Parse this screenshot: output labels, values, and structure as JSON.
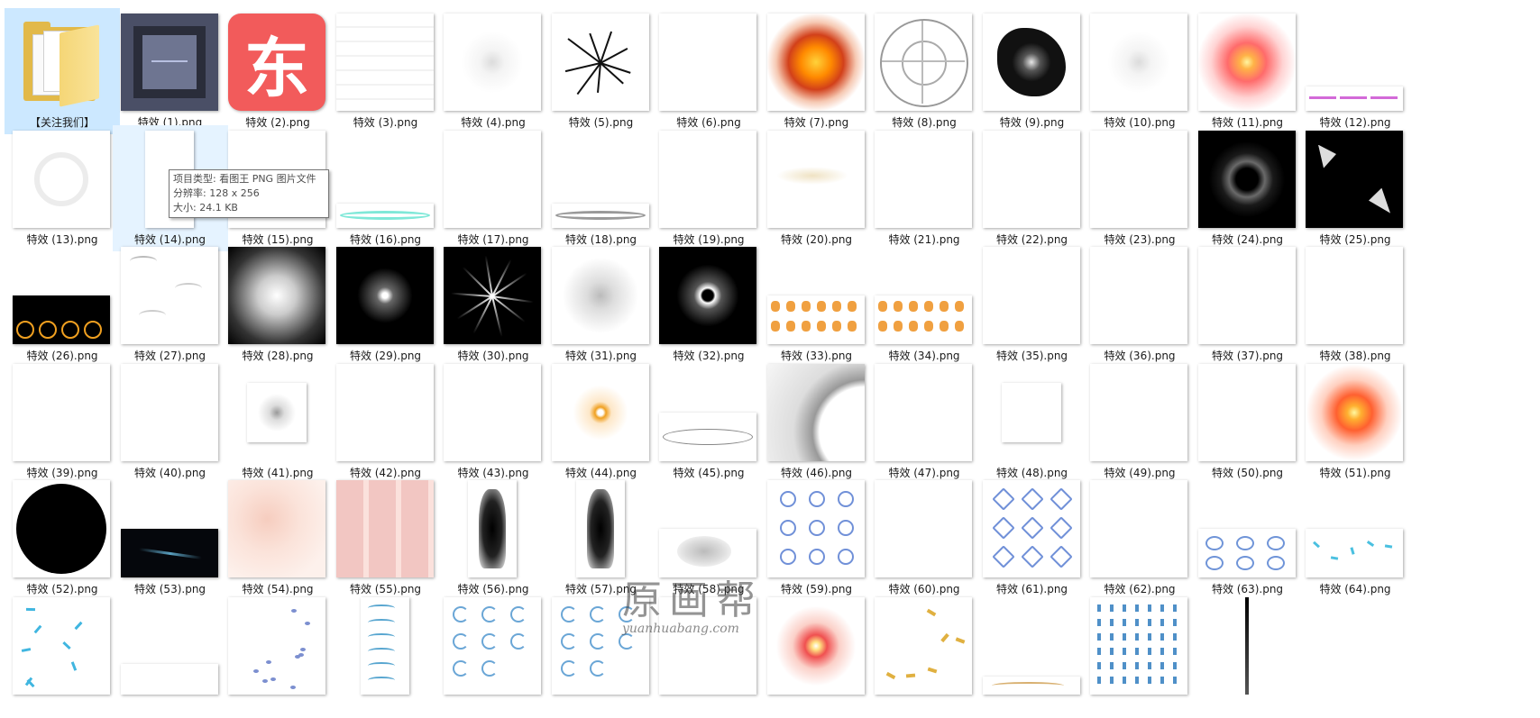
{
  "folder": {
    "label": "【关注我们】"
  },
  "dong_glyph": "东",
  "tooltip": {
    "type_line": "项目类型: 看图王 PNG 图片文件",
    "resolution_line": "分辨率: 128 x 256",
    "size_line": "大小: 24.1 KB"
  },
  "watermark": {
    "main": "原画帮",
    "url": "yuanhuabang.com"
  },
  "files": [
    {
      "label": "特效 (1).png",
      "thumb": "dark-frame"
    },
    {
      "label": "特效 (2).png",
      "thumb": "red-logo"
    },
    {
      "label": "特效 (3).png",
      "thumb": "faint-strokes"
    },
    {
      "label": "特效 (4).png",
      "thumb": "faint-burst"
    },
    {
      "label": "特效 (5).png",
      "thumb": "black-crack"
    },
    {
      "label": "特效 (6).png",
      "thumb": "blank"
    },
    {
      "label": "特效 (7).png",
      "thumb": "fire-crack"
    },
    {
      "label": "特效 (8).png",
      "thumb": "magic-circle"
    },
    {
      "label": "特效 (9).png",
      "thumb": "black-splash"
    },
    {
      "label": "特效 (10).png",
      "thumb": "faint-burst"
    },
    {
      "label": "特效 (11).png",
      "thumb": "red-flare"
    },
    {
      "label": "特效 (12).png",
      "thumb": "pink-lines"
    },
    {
      "label": "特效 (13).png",
      "thumb": "faint-ring"
    },
    {
      "label": "特效 (14).png",
      "thumb": "blank-tall"
    },
    {
      "label": "特效 (15).png",
      "thumb": "blank"
    },
    {
      "label": "特效 (16).png",
      "thumb": "cyan-ring"
    },
    {
      "label": "特效 (17).png",
      "thumb": "blank"
    },
    {
      "label": "特效 (18).png",
      "thumb": "grey-ring"
    },
    {
      "label": "特效 (19).png",
      "thumb": "blank"
    },
    {
      "label": "特效 (20).png",
      "thumb": "beige-smear"
    },
    {
      "label": "特效 (21).png",
      "thumb": "blank"
    },
    {
      "label": "特效 (22).png",
      "thumb": "blank"
    },
    {
      "label": "特效 (23).png",
      "thumb": "blank"
    },
    {
      "label": "特效 (24).png",
      "thumb": "black-ring"
    },
    {
      "label": "特效 (25).png",
      "thumb": "black-shards"
    },
    {
      "label": "特效 (26).png",
      "thumb": "fire-rings"
    },
    {
      "label": "特效 (27).png",
      "thumb": "grey-wisps"
    },
    {
      "label": "特效 (28).png",
      "thumb": "white-glow-dark"
    },
    {
      "label": "特效 (29).png",
      "thumb": "white-star-dark"
    },
    {
      "label": "特效 (30).png",
      "thumb": "rays-dark"
    },
    {
      "label": "特效 (31).png",
      "thumb": "grey-star"
    },
    {
      "label": "特效 (32).png",
      "thumb": "dark-hole"
    },
    {
      "label": "特效 (33).png",
      "thumb": "orange-frames"
    },
    {
      "label": "特效 (34).png",
      "thumb": "orange-frames"
    },
    {
      "label": "特效 (35).png",
      "thumb": "blank"
    },
    {
      "label": "特效 (36).png",
      "thumb": "blank"
    },
    {
      "label": "特效 (37).png",
      "thumb": "blank"
    },
    {
      "label": "特效 (38).png",
      "thumb": "blank"
    },
    {
      "label": "特效 (39).png",
      "thumb": "blank"
    },
    {
      "label": "特效 (40).png",
      "thumb": "blank"
    },
    {
      "label": "特效 (41).png",
      "thumb": "grey-dot-small"
    },
    {
      "label": "特效 (42).png",
      "thumb": "blank"
    },
    {
      "label": "特效 (43).png",
      "thumb": "blank"
    },
    {
      "label": "特效 (44).png",
      "thumb": "orange-dot"
    },
    {
      "label": "特效 (45).png",
      "thumb": "lens-line"
    },
    {
      "label": "特效 (46).png",
      "thumb": "grey-arc"
    },
    {
      "label": "特效 (47).png",
      "thumb": "blank"
    },
    {
      "label": "特效 (48).png",
      "thumb": "blank-small"
    },
    {
      "label": "特效 (49).png",
      "thumb": "blank"
    },
    {
      "label": "特效 (50).png",
      "thumb": "blank"
    },
    {
      "label": "特效 (51).png",
      "thumb": "orange-sun"
    },
    {
      "label": "特效 (52).png",
      "thumb": "black-circle"
    },
    {
      "label": "特效 (53).png",
      "thumb": "dark-streak"
    },
    {
      "label": "特效 (54).png",
      "thumb": "pink-hands"
    },
    {
      "label": "特效 (55).png",
      "thumb": "pink-blocks"
    },
    {
      "label": "特效 (56).png",
      "thumb": "black-blob"
    },
    {
      "label": "特效 (57).png",
      "thumb": "black-blob"
    },
    {
      "label": "特效 (58).png",
      "thumb": "grey-smoke"
    },
    {
      "label": "特效 (59).png",
      "thumb": "blue-swirls"
    },
    {
      "label": "特效 (60).png",
      "thumb": "blank"
    },
    {
      "label": "特效 (61).png",
      "thumb": "blue-stars"
    },
    {
      "label": "特效 (62).png",
      "thumb": "blank"
    },
    {
      "label": "特效 (63).png",
      "thumb": "blue-rings"
    },
    {
      "label": "特效 (64).png",
      "thumb": "cyan-sparks"
    },
    {
      "label": "",
      "thumb": "cyan-sparks-sq"
    },
    {
      "label": "",
      "thumb": "blank-partial"
    },
    {
      "label": "",
      "thumb": "blue-dots"
    },
    {
      "label": "",
      "thumb": "blue-waves-tall"
    },
    {
      "label": "",
      "thumb": "blue-curls"
    },
    {
      "label": "",
      "thumb": "blue-curls"
    },
    {
      "label": "",
      "thumb": "blank"
    },
    {
      "label": "",
      "thumb": "red-star-flare"
    },
    {
      "label": "",
      "thumb": "gold-sparks"
    },
    {
      "label": "",
      "thumb": "gold-partial"
    },
    {
      "label": "",
      "thumb": "blue-vertical"
    },
    {
      "label": "",
      "thumb": "black-line"
    }
  ]
}
